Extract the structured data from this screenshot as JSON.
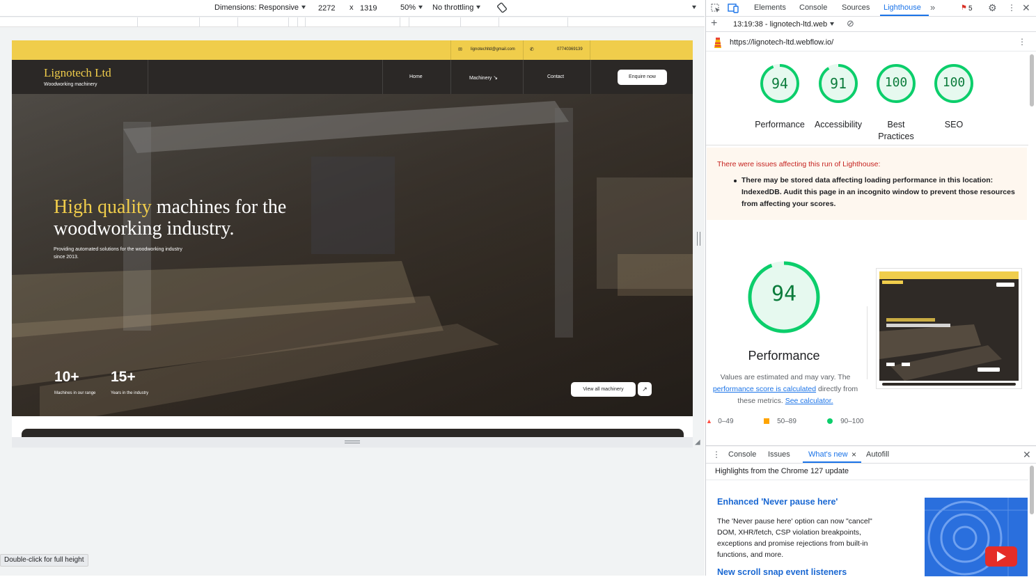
{
  "device_toolbar": {
    "dimensions_label": "Dimensions: Responsive",
    "width": "2272",
    "times": "x",
    "height": "1319",
    "zoom": "50%",
    "throttling": "No throttling"
  },
  "site": {
    "email": "lignotechltd@gmail.com",
    "phone": "07740369139",
    "brand": "Lignotech Ltd",
    "tagline": "Woodworking machinery",
    "nav": {
      "home": "Home",
      "machinery": "Machinery",
      "contact": "Contact"
    },
    "enquire": "Enquire now",
    "headline_highlight": "High quality",
    "headline_rest": " machines for the woodworking industry.",
    "subtext": "Providing automated solutions for the woodworking industry since 2013.",
    "stats": [
      {
        "value": "10+",
        "label": "Machines in our range"
      },
      {
        "value": "15+",
        "label": "Years in the industry"
      }
    ],
    "view_all": "View all machinery",
    "arrow": "↗"
  },
  "tooltip": "Double-click for full height",
  "devtools": {
    "tabs": [
      "Elements",
      "Console",
      "Sources",
      "Lighthouse"
    ],
    "active_tab": "Lighthouse",
    "issues_count": "5",
    "report_select": "13:19:38 - lignotech-ltd.web",
    "url": "https://lignotech-ltd.webflow.io/",
    "scores": [
      {
        "value": "94",
        "label": "Performance",
        "fraction": 0.94
      },
      {
        "value": "91",
        "label": "Accessibility",
        "fraction": 0.91
      },
      {
        "value": "100",
        "label": "Best Practices",
        "fraction": 1.0
      },
      {
        "value": "100",
        "label": "SEO",
        "fraction": 1.0
      }
    ],
    "warning_title": "There were issues affecting this run of Lighthouse:",
    "warning_item": "There may be stored data affecting loading performance in this location: IndexedDB. Audit this page in an incognito window to prevent those resources from affecting your scores.",
    "perf_score": "94",
    "perf_fraction": 0.94,
    "perf_title": "Performance",
    "perf_desc_1": "Values are estimated and may vary. The",
    "perf_link_1": "performance score is calculated",
    "perf_desc_2": "directly from these metrics.",
    "perf_link_2": "See calculator.",
    "legend": [
      "0–49",
      "50–89",
      "90–100"
    ],
    "colors": {
      "pass": "#0cce6b",
      "average": "#ffa400",
      "fail": "#ff4e42",
      "accent": "#1a73e8"
    }
  },
  "drawer": {
    "tabs": [
      "Console",
      "Issues",
      "What's new",
      "Autofill"
    ],
    "active_tab": "What's new",
    "close_x": "×",
    "highlights": "Highlights from the Chrome 127 update",
    "feature1_title": "Enhanced 'Never pause here'",
    "feature1_text": "The 'Never pause here' option can now \"cancel\" DOM, XHR/fetch, CSP violation breakpoints, exceptions and promise rejections from built-in functions, and more.",
    "feature2_title": "New scroll snap event listeners"
  }
}
